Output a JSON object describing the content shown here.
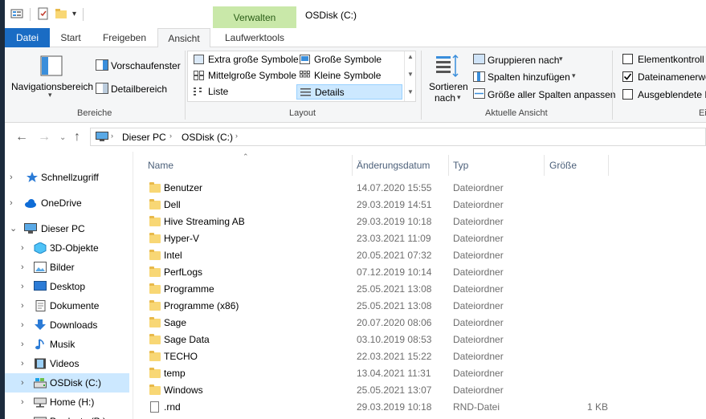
{
  "window": {
    "title": "OSDisk (C:)",
    "context_tab": "Verwalten"
  },
  "tabs": [
    {
      "label": "Datei"
    },
    {
      "label": "Start"
    },
    {
      "label": "Freigeben"
    },
    {
      "label": "Ansicht"
    },
    {
      "label": "Laufwerktools"
    }
  ],
  "ribbon": {
    "bereiche": {
      "nav_pane": "Navigationsbereich",
      "preview": "Vorschaufenster",
      "details": "Detailbereich",
      "label": "Bereiche"
    },
    "layout": {
      "items": [
        {
          "label": "Extra große Symbole"
        },
        {
          "label": "Große Symbole"
        },
        {
          "label": "Mittelgroße Symbole"
        },
        {
          "label": "Kleine Symbole"
        },
        {
          "label": "Liste"
        },
        {
          "label": "Details"
        }
      ],
      "label": "Layout"
    },
    "current_view": {
      "sort_line1": "Sortieren",
      "sort_line2": "nach",
      "group_by": "Gruppieren nach",
      "add_columns": "Spalten hinzufügen",
      "size_all": "Größe aller Spalten anpassen",
      "label": "Aktuelle Ansicht"
    },
    "show_hide": {
      "item_checkboxes": "Elementkontroll",
      "file_ext": "Dateinamenerwe",
      "hidden": "Ausgeblendete E",
      "label": "Ei"
    }
  },
  "address": {
    "crumbs": [
      {
        "label": "Dieser PC"
      },
      {
        "label": "OSDisk (C:)"
      }
    ]
  },
  "nav": {
    "items": [
      {
        "label": "Schnellzugriff"
      },
      {
        "label": "OneDrive"
      },
      {
        "label": "Dieser PC"
      },
      {
        "label": "3D-Objekte"
      },
      {
        "label": "Bilder"
      },
      {
        "label": "Desktop"
      },
      {
        "label": "Dokumente"
      },
      {
        "label": "Downloads"
      },
      {
        "label": "Musik"
      },
      {
        "label": "Videos"
      },
      {
        "label": "OSDisk (C:)"
      },
      {
        "label": "Home (H:)"
      },
      {
        "label": "Products (P:)"
      }
    ]
  },
  "columns": {
    "name": "Name",
    "date": "Änderungsdatum",
    "type": "Typ",
    "size": "Größe"
  },
  "files": [
    {
      "name": "Benutzer",
      "date": "14.07.2020 15:55",
      "type": "Dateiordner",
      "size": ""
    },
    {
      "name": "Dell",
      "date": "29.03.2019 14:51",
      "type": "Dateiordner",
      "size": ""
    },
    {
      "name": "Hive Streaming AB",
      "date": "29.03.2019 10:18",
      "type": "Dateiordner",
      "size": ""
    },
    {
      "name": "Hyper-V",
      "date": "23.03.2021 11:09",
      "type": "Dateiordner",
      "size": ""
    },
    {
      "name": "Intel",
      "date": "20.05.2021 07:32",
      "type": "Dateiordner",
      "size": ""
    },
    {
      "name": "PerfLogs",
      "date": "07.12.2019 10:14",
      "type": "Dateiordner",
      "size": ""
    },
    {
      "name": "Programme",
      "date": "25.05.2021 13:08",
      "type": "Dateiordner",
      "size": ""
    },
    {
      "name": "Programme (x86)",
      "date": "25.05.2021 13:08",
      "type": "Dateiordner",
      "size": ""
    },
    {
      "name": "Sage",
      "date": "20.07.2020 08:06",
      "type": "Dateiordner",
      "size": ""
    },
    {
      "name": "Sage Data",
      "date": "03.10.2019 08:53",
      "type": "Dateiordner",
      "size": ""
    },
    {
      "name": "TECHO",
      "date": "22.03.2021 15:22",
      "type": "Dateiordner",
      "size": ""
    },
    {
      "name": "temp",
      "date": "13.04.2021 11:31",
      "type": "Dateiordner",
      "size": ""
    },
    {
      "name": "Windows",
      "date": "25.05.2021 13:07",
      "type": "Dateiordner",
      "size": ""
    },
    {
      "name": ".rnd",
      "date": "29.03.2019 10:18",
      "type": "RND-Datei",
      "size": "1 KB"
    }
  ],
  "colors": {
    "file_tab": "#1a6cc4",
    "context_tab": "#c9e8a9",
    "selection": "#cce8ff",
    "folder": "#f8d775"
  }
}
